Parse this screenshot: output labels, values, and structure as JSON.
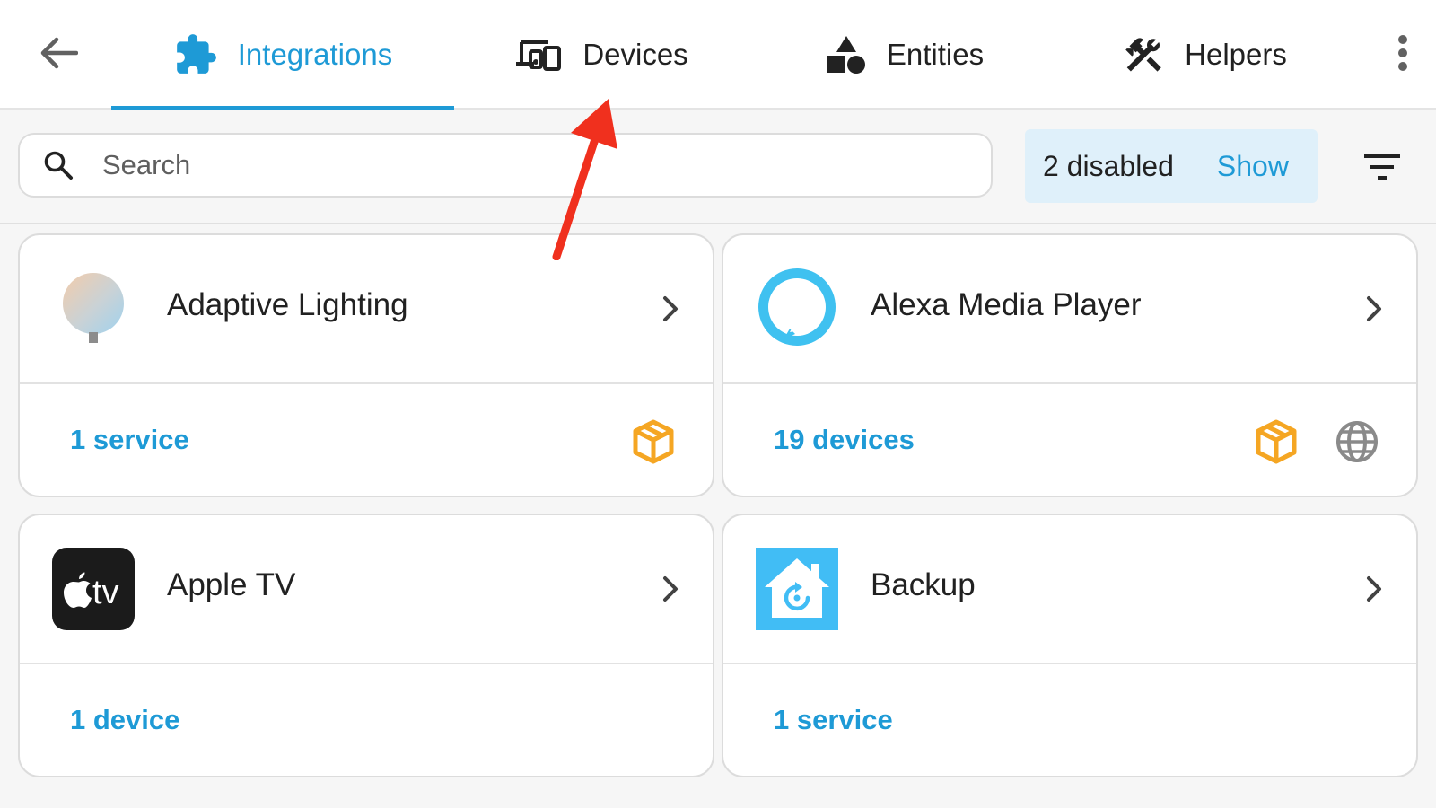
{
  "header": {
    "tabs": [
      {
        "label": "Integrations",
        "icon": "puzzle-icon",
        "active": true
      },
      {
        "label": "Devices",
        "icon": "devices-icon",
        "active": false
      },
      {
        "label": "Entities",
        "icon": "shapes-icon",
        "active": false
      },
      {
        "label": "Helpers",
        "icon": "tools-icon",
        "active": false
      }
    ]
  },
  "toolbar": {
    "search_placeholder": "Search",
    "disabled_text": "2 disabled",
    "show_label": "Show"
  },
  "integrations": [
    {
      "name": "Adaptive Lighting",
      "link": "1 service",
      "logo": "adaptive-lighting-logo",
      "badges": [
        "custom-integration-icon"
      ]
    },
    {
      "name": "Alexa Media Player",
      "link": "19 devices",
      "logo": "alexa-logo",
      "badges": [
        "custom-integration-icon",
        "cloud-polling-globe-icon"
      ]
    },
    {
      "name": "Apple TV",
      "link": "1 device",
      "logo": "apple-tv-logo",
      "logo_text": "tv",
      "badges": []
    },
    {
      "name": "Backup",
      "link": "1 service",
      "logo": "backup-logo",
      "badges": []
    }
  ],
  "colors": {
    "accent": "#1e9ad6",
    "custom_badge": "#f5a623",
    "chip_background": "#dff0fa",
    "annotation_arrow": "#f0301e"
  }
}
